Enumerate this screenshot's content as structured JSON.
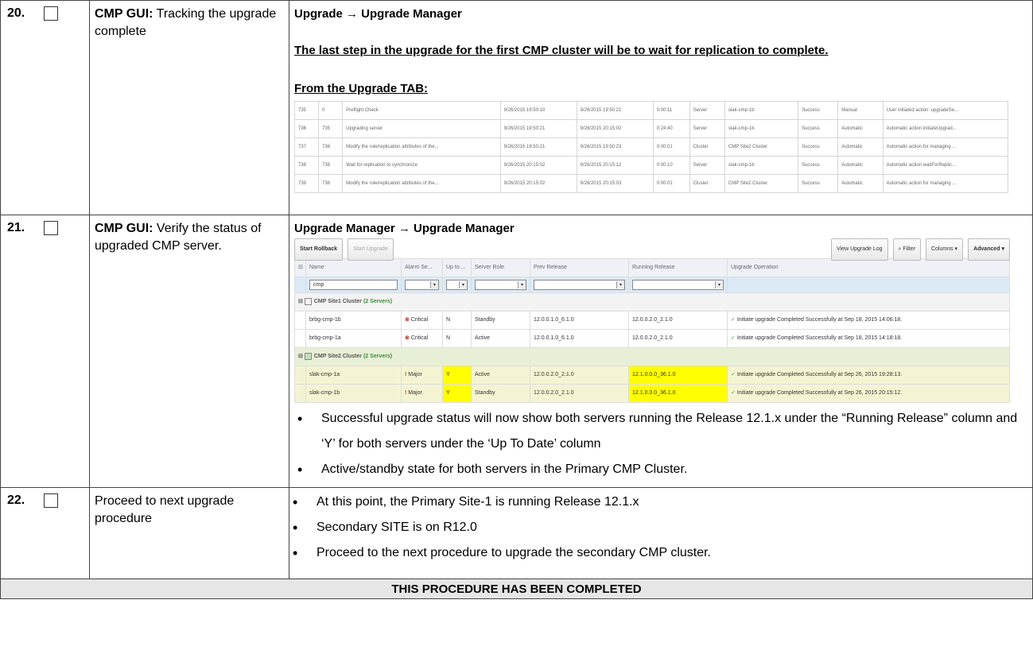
{
  "rows": [
    {
      "num": "20.",
      "desc_bold": "CMP GUI:",
      "desc_text": " Tracking the upgrade complete",
      "heading": "Upgrade → Upgrade Manager",
      "note": "The last step in the upgrade for the first CMP cluster will be to wait for replication to complete.",
      "subheading": "From the Upgrade TAB:",
      "upgrade_tab_rows": [
        [
          "735",
          "0",
          "Preflight Check",
          "9/26/2015 19:50:10",
          "9/26/2015 19:50:21",
          "0:00:11",
          "Server",
          "slak-cmp-1b",
          "Success",
          "Manual",
          "User initiated action: upgradeSe..."
        ],
        [
          "736",
          "735",
          "Upgrading server",
          "9/26/2015 19:50:21",
          "9/26/2015 20:15:02",
          "0:24:40",
          "Server",
          "slak-cmp-1b",
          "Success",
          "Automatic",
          "Automatic action initiateUpgrad..."
        ],
        [
          "737",
          "736",
          "Modify the role/replication attributes of the...",
          "9/26/2015 19:50:21",
          "9/26/2015 19:50:23",
          "0:00:01",
          "Cluster",
          "CMP Site2 Cluster",
          "Success",
          "Automatic",
          "Automatic action for managing ..."
        ],
        [
          "738",
          "736",
          "Wait for replication to synchronize",
          "9/26/2015 20:15:02",
          "9/26/2015 20:15:12",
          "0:00:10",
          "Server",
          "slak-cmp-1b",
          "Success",
          "Automatic",
          "Automatic action waitForReplic..."
        ],
        [
          "739",
          "736",
          "Modify the role/replication attributes of the...",
          "9/26/2015 20:15:02",
          "9/26/2015 20:15:03",
          "0:00:01",
          "Cluster",
          "CMP Site2 Cluster",
          "Success",
          "Automatic",
          "Automatic action for managing ..."
        ]
      ]
    },
    {
      "num": "21.",
      "desc_bold": "CMP GUI:",
      "desc_text": " Verify the status of upgraded CMP server.",
      "heading": "Upgrade Manager → Upgrade Manager",
      "toolbar": {
        "start_rollback": "Start Rollback",
        "start_upgrade": "Start Upgrade",
        "view_log": "View Upgrade Log",
        "filter": "Filter",
        "columns": "Columns ▾",
        "advanced": "Advanced ▾"
      },
      "columns": [
        "Name",
        "Alarm Se...",
        "Up to ...",
        "Server Role",
        "Prev Release",
        "Running Release",
        "Upgrade Operation"
      ],
      "filter_value": "cmp",
      "groups": [
        {
          "name": "CMP Site1 Cluster",
          "count": "(2 Servers)",
          "servers": [
            {
              "name": "brbg-cmp-1b",
              "alarm": "Critical",
              "uptodate": "N",
              "role": "Standby",
              "prev": "12.0.0.1.0_6.1.0",
              "running": "12.0.0.2.0_2.1.0",
              "op": "Initiate upgrade Completed Successfully at Sep 18, 2015 14:06:18."
            },
            {
              "name": "brbg-cmp-1a",
              "alarm": "Critical",
              "uptodate": "N",
              "role": "Active",
              "prev": "12.0.0.1.0_6.1.0",
              "running": "12.0.0.2.0_2.1.0",
              "op": "Initiate upgrade Completed Successfully at Sep 18, 2015 14:18:18."
            }
          ]
        },
        {
          "name": "CMP Site2 Cluster",
          "count": "(2 Servers)",
          "servers": [
            {
              "name": "slak-cmp-1a",
              "alarm": "Major",
              "uptodate": "Y",
              "role": "Active",
              "prev": "12.0.0.2.0_2.1.0",
              "running": "12.1.0.0.0_36.1.0",
              "op": "Initiate upgrade Completed Successfully at Sep 26, 2015 19:28:13."
            },
            {
              "name": "slak-cmp-1b",
              "alarm": "Major",
              "uptodate": "Y",
              "role": "Standby",
              "prev": "12.0.0.2.0_2.1.0",
              "running": "12.1.0.0.0_36.1.0",
              "op": "Initiate upgrade Completed Successfully at Sep 26, 2015 20:15:12."
            }
          ]
        }
      ],
      "bullets": [
        "Successful upgrade status will now show both servers running the Release 12.1.x under the “Running Release” column and ‘Y’ for both servers under the ‘Up To Date’ column",
        "Active/standby state for both servers in the Primary CMP Cluster."
      ]
    },
    {
      "num": "22.",
      "desc_text": "Proceed to next upgrade procedure",
      "bullets": [
        "At this point, the Primary Site-1 is running Release 12.1.x",
        "Secondary SITE is on R12.0",
        "Proceed to the next procedure to upgrade the secondary CMP cluster."
      ]
    }
  ],
  "footer": "THIS PROCEDURE HAS BEEN COMPLETED"
}
